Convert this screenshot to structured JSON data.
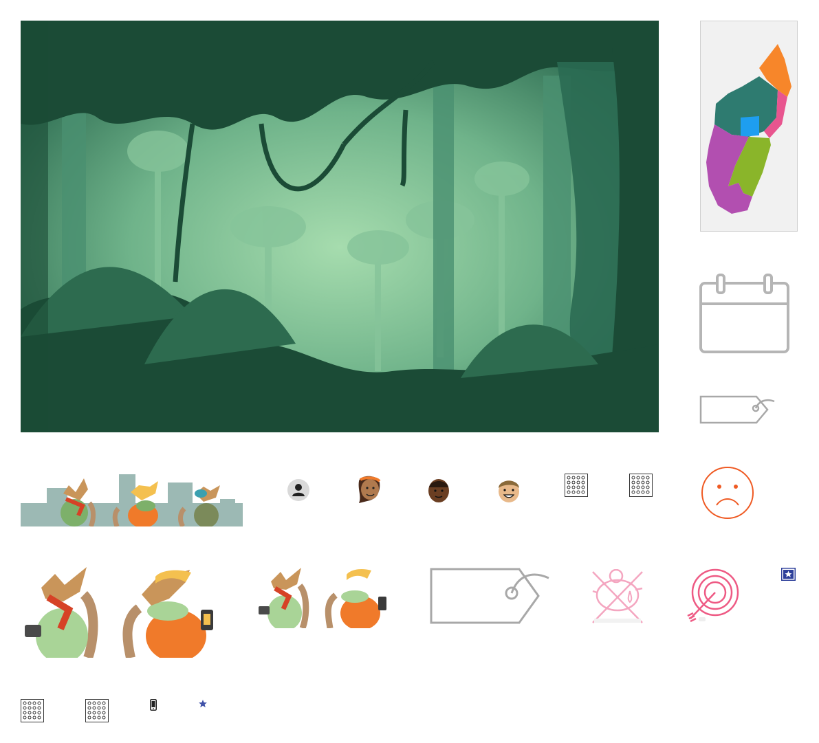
{
  "assets": {
    "hero": {
      "icon": "jungle-scene-illustration",
      "colors": {
        "dark": "#1b4b36",
        "mid": "#3c7a5c",
        "light": "#9fd8a8"
      }
    },
    "map": {
      "icon": "madagascar-regions-map",
      "colors": {
        "orange": "#f7862a",
        "teal": "#2e7b70",
        "blue": "#1e9ef0",
        "pink": "#e8558f",
        "green": "#8ab52a",
        "purple": "#b24fb0"
      }
    },
    "calendar": {
      "icon": "calendar-icon",
      "color": "#b5b5b5"
    },
    "tag_small": {
      "icon": "price-tag-icon",
      "color": "#a8a8a8"
    },
    "tag_large": {
      "icon": "price-tag-icon",
      "color": "#a8a8a8"
    },
    "sad_face": {
      "icon": "sad-face-icon",
      "color": "#ef5a23"
    },
    "no_savings": {
      "icon": "crossed-piggy-bank-icon",
      "color": "#f4a6c0"
    },
    "target": {
      "icon": "target-arrow-icon",
      "color": "#ee5a84"
    },
    "star_badge": {
      "icon": "star-badge-icon",
      "color": "#2d3f9a"
    },
    "star": {
      "icon": "star-icon",
      "color": "#3f51a8"
    },
    "phone": {
      "icon": "smartphone-icon",
      "color": "#222222"
    },
    "grid_icons": [
      "dot-grid-icon",
      "dot-grid-icon",
      "dot-grid-icon",
      "dot-grid-icon"
    ],
    "avatars": [
      "user-silhouette-avatar",
      "woman-avatar",
      "man-avatar",
      "smiling-man-avatar"
    ],
    "lemurs": [
      "lemurs-city-illustration",
      "lemurs-large-illustration",
      "lemurs-small-illustration"
    ]
  }
}
